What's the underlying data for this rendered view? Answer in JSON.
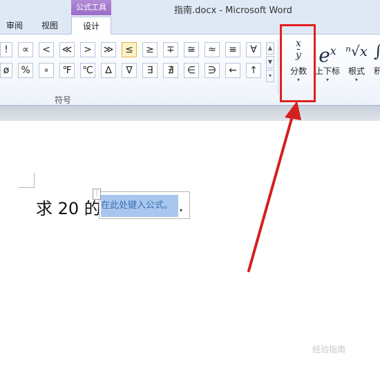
{
  "window": {
    "title": "指南.docx  -  Microsoft Word"
  },
  "context_tab_group": "公式工具",
  "tabs": [
    {
      "label": "审阅"
    },
    {
      "label": "视图"
    },
    {
      "label": "设计",
      "active": true
    }
  ],
  "symbol_gallery": {
    "row1": [
      "!",
      "∝",
      "<",
      "≪",
      ">",
      "≫",
      "≤",
      "≥",
      "∓",
      "≅",
      "≈",
      "≡",
      "∀"
    ],
    "row2": [
      "ø",
      "%",
      "∘",
      "℉",
      "℃",
      "∆",
      "∇",
      "∃",
      "∄",
      "∈",
      "∋",
      "←",
      "↑"
    ],
    "highlighted": "≤",
    "scroll_up": "▲",
    "scroll_down": "▼",
    "more": "▾"
  },
  "group_label": "符号",
  "structures": [
    {
      "label": "分数",
      "glyph_num": "x",
      "glyph_den": "y"
    },
    {
      "label": "上下标",
      "glyph": "e",
      "glyph_sup": "x"
    },
    {
      "label": "根式",
      "glyph": "ⁿ√x"
    },
    {
      "label": "积"
    }
  ],
  "document": {
    "paragraph_text": "求 20 的",
    "equation_placeholder": "在此处键入公式。",
    "equation_dropdown": "▾"
  },
  "watermark": "经验指南",
  "colors": {
    "annotation": "#e02020",
    "context_tab": "#9a6cc8",
    "equation_highlight": "#a9c7ee"
  }
}
